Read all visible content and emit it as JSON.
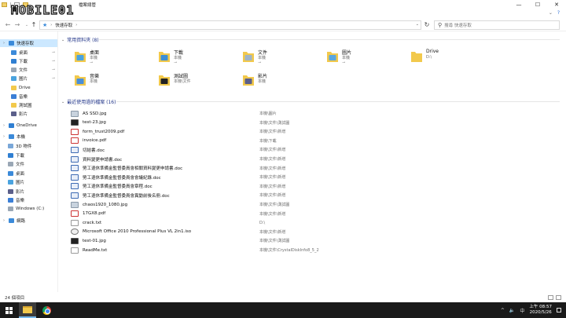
{
  "window": {
    "title": "檔案總管",
    "min_glyph": "—",
    "max_glyph": "☐",
    "close_glyph": "✕"
  },
  "watermark": {
    "text": "MOBILE01"
  },
  "ribbon": {
    "tabs": [
      "檔案",
      "常用",
      "共用",
      "檢視"
    ],
    "expand_glyph": "⌄",
    "help_glyph": "?"
  },
  "address": {
    "breadcrumb": "快速存取",
    "back_glyph": "←",
    "forward_glyph": "→",
    "up_glyph": "↑",
    "dropdown_glyph": "⌄",
    "refresh_glyph": "↻",
    "search_placeholder": "搜尋 快速存取"
  },
  "sidebar": {
    "items": [
      {
        "label": "快速存取",
        "icon": "star-icon",
        "pinned": false,
        "selected": true
      },
      {
        "label": "桌面",
        "icon": "desktop-icon",
        "pinned": true
      },
      {
        "label": "下載",
        "icon": "download-icon",
        "pinned": true
      },
      {
        "label": "文件",
        "icon": "documents-icon",
        "pinned": true
      },
      {
        "label": "圖片",
        "icon": "pictures-icon",
        "pinned": true
      },
      {
        "label": "Drive",
        "icon": "folder-icon",
        "pinned": false
      },
      {
        "label": "音樂",
        "icon": "music-icon",
        "pinned": false
      },
      {
        "label": "測試圖",
        "icon": "folder-icon",
        "pinned": false
      },
      {
        "label": "影片",
        "icon": "videos-icon",
        "pinned": false
      },
      {
        "label": "OneDrive",
        "icon": "cloud-icon",
        "pinned": false
      },
      {
        "label": "本機",
        "icon": "computer-icon",
        "pinned": false
      },
      {
        "label": "3D 物件",
        "icon": "cube-icon",
        "pinned": false
      },
      {
        "label": "下載",
        "icon": "download-icon",
        "pinned": false
      },
      {
        "label": "文件",
        "icon": "documents-icon",
        "pinned": false
      },
      {
        "label": "桌面",
        "icon": "desktop-icon",
        "pinned": false
      },
      {
        "label": "圖片",
        "icon": "pictures-icon",
        "pinned": false
      },
      {
        "label": "影片",
        "icon": "videos-icon",
        "pinned": false
      },
      {
        "label": "音樂",
        "icon": "music-icon",
        "pinned": false
      },
      {
        "label": "Windows (C:)",
        "icon": "drive-icon",
        "pinned": false
      },
      {
        "label": "網路",
        "icon": "network-icon",
        "pinned": false
      }
    ]
  },
  "frequent": {
    "header": "常用資料夾 (8)",
    "folders": [
      {
        "name": "桌面",
        "location": "本機",
        "pinned": true,
        "color": "#4aa3df"
      },
      {
        "name": "下載",
        "location": "本機",
        "pinned": true,
        "color": "#3d8fd6"
      },
      {
        "name": "文件",
        "location": "本機",
        "pinned": true,
        "color": "#9fb4c8"
      },
      {
        "name": "圖片",
        "location": "本機",
        "pinned": true,
        "color": "#5aa7e0"
      },
      {
        "name": "Drive",
        "location": "D:\\",
        "pinned": false,
        "color": "#f2c94c"
      },
      {
        "name": "音樂",
        "location": "本機",
        "pinned": false,
        "color": "#4a8fd9"
      },
      {
        "name": "測試圖",
        "location": "本機\\文件",
        "pinned": false,
        "color": "#222222"
      },
      {
        "name": "影片",
        "location": "本機",
        "pinned": false,
        "color": "#5b5f8a"
      }
    ]
  },
  "recent": {
    "header": "最近使用過的檔案 (16)",
    "files": [
      {
        "name": "AS SSD.jpg",
        "location": "本機\\圖片",
        "type": "image"
      },
      {
        "name": "test-23.jpg",
        "location": "本機\\文件\\測試圖",
        "type": "image-dark"
      },
      {
        "name": "form_trust2009.pdf",
        "location": "本機\\文件\\新增",
        "type": "pdf"
      },
      {
        "name": "invoice.pdf",
        "location": "本機\\下載",
        "type": "pdf"
      },
      {
        "name": "切結書.doc",
        "location": "本機\\文件\\新增",
        "type": "doc"
      },
      {
        "name": "資料變更申請書.doc",
        "location": "本機\\文件\\新增",
        "type": "doc"
      },
      {
        "name": "勞工退休準備金監督委員會相關資料變更申請書.doc",
        "location": "本機\\文件\\新增",
        "type": "doc"
      },
      {
        "name": "勞工退休準備金監督委員會會議紀錄.doc",
        "location": "本機\\文件\\新增",
        "type": "doc"
      },
      {
        "name": "勞工退休準備金監督委員會章程.doc",
        "location": "本機\\文件\\新增",
        "type": "doc"
      },
      {
        "name": "勞工退休準備金監督委員會異動前後名冊.doc",
        "location": "本機\\文件\\新增",
        "type": "doc"
      },
      {
        "name": "chaos1920_1080.jpg",
        "location": "本機\\文件\\測試圖",
        "type": "image"
      },
      {
        "name": "17GX8.pdf",
        "location": "本機\\文件\\新增",
        "type": "pdf"
      },
      {
        "name": "crack.txt",
        "location": "D:\\",
        "type": "txt"
      },
      {
        "name": "Microsoft Office 2010 Professional Plus VL 2in1.iso",
        "location": "本機\\文件\\新增",
        "type": "iso"
      },
      {
        "name": "test-01.jpg",
        "location": "本機\\文件\\測試圖",
        "type": "image-dark"
      },
      {
        "name": "ReadMe.txt",
        "location": "本機\\文件\\CrystalDiskInfo8_5_2",
        "type": "txt"
      }
    ]
  },
  "status": {
    "count": "24 個項目"
  },
  "taskbar": {
    "time": "上午 08:57",
    "date": "2020/5/26",
    "ime": "中",
    "tray_chevron": "^",
    "volume": "🔈"
  },
  "colors": {
    "accent": "#0078d7",
    "selected_bg": "#cce8ff",
    "taskbar": "#1a1a1a",
    "folder": "#f2c94c"
  }
}
